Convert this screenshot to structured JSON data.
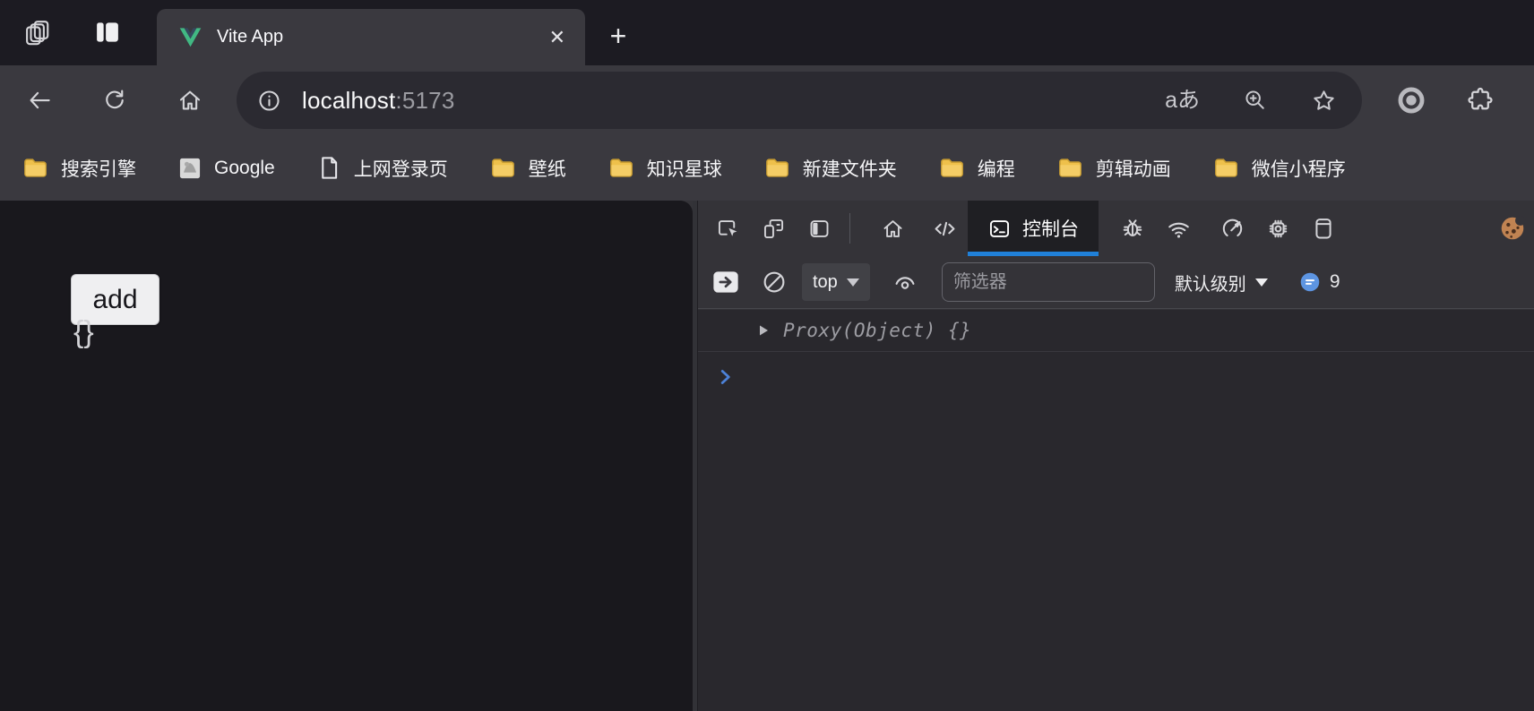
{
  "browser": {
    "tab": {
      "title": "Vite App",
      "close_glyph": "✕",
      "new_tab_glyph": "+"
    },
    "urlbar": {
      "host": "localhost",
      "port": ":5173",
      "translate_glyph": "aあ"
    },
    "bookmarks": [
      {
        "label": "搜索引擎",
        "icon": "folder-icon"
      },
      {
        "label": "Google",
        "icon": "google-favicon"
      },
      {
        "label": "上网登录页",
        "icon": "page-icon"
      },
      {
        "label": "壁纸",
        "icon": "folder-icon"
      },
      {
        "label": "知识星球",
        "icon": "folder-icon"
      },
      {
        "label": "新建文件夹",
        "icon": "folder-icon"
      },
      {
        "label": "编程",
        "icon": "folder-icon"
      },
      {
        "label": "剪辑动画",
        "icon": "folder-icon"
      },
      {
        "label": "微信小程序",
        "icon": "folder-icon"
      }
    ]
  },
  "page": {
    "add_button_label": "add",
    "braces_text": "{}"
  },
  "devtools": {
    "tabs": {
      "console_label": "控制台"
    },
    "toolbar": {
      "context_selector": "top",
      "filter_placeholder": "筛选器",
      "levels_label": "默认级别",
      "issues_count": "9"
    },
    "console": {
      "log_preview": "Proxy(Object) {}"
    }
  },
  "colors": {
    "accent_blue": "#2080d8",
    "prompt_blue": "#4d82d8",
    "issues_bubble_blue": "#5d95e2",
    "folder_yellow": "#eec04b",
    "vue_green": "#41b883",
    "vue_dark": "#35495e",
    "toolbar_bg": "#3a393f",
    "tabstrip_bg": "#1c1b22",
    "devtools_bg": "#343338",
    "console_bg": "#29282d",
    "page_bg": "#19181d"
  }
}
